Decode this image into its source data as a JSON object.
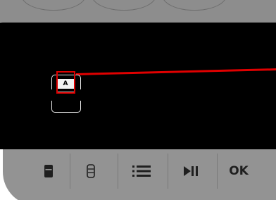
{
  "colors": {
    "screen": "#000000",
    "bezel": "#939393",
    "highlight": "#e00000",
    "icon": "#1f1f1f"
  },
  "screen": {
    "item_tag": "A"
  },
  "toolbar": {
    "buttons": [
      {
        "icon": "single-slot-icon"
      },
      {
        "icon": "stack-icon"
      },
      {
        "icon": "list-icon"
      },
      {
        "icon": "play-pause-icon"
      },
      {
        "label": "OK"
      }
    ]
  }
}
